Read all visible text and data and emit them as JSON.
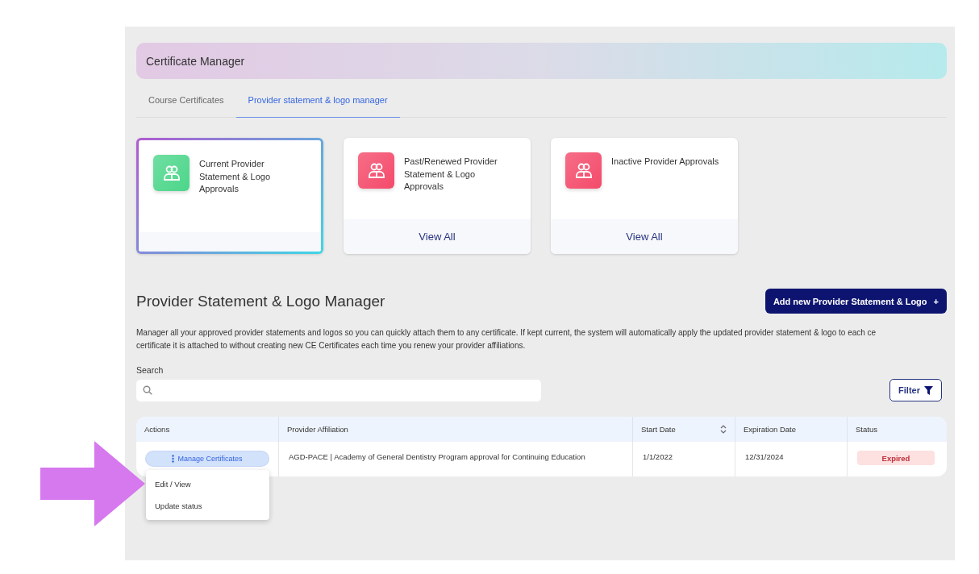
{
  "header": {
    "title": "Certificate Manager"
  },
  "tabs": [
    {
      "label": "Course Certificates",
      "selected": false
    },
    {
      "label": "Provider statement & logo manager",
      "selected": true
    }
  ],
  "cards": [
    {
      "title": "Current Provider Statement & Logo Approvals",
      "selected": true,
      "color": "#4cd68a"
    },
    {
      "title": "Past/Renewed Provider Statement & Logo Approvals",
      "selected": false,
      "color": "#f44a6a",
      "footer": "View All"
    },
    {
      "title": "Inactive Provider Approvals",
      "selected": false,
      "color": "#f44a6a",
      "footer": "View All"
    }
  ],
  "section": {
    "heading": "Provider Statement & Logo Manager",
    "add_button": "Add new Provider Statement & Logo",
    "add_icon": "+",
    "description_lines": [
      "Manager all your approved provider statements and logos so you can quickly attach them to any certificate. If kept current, the system will automatically apply the updated provider statement & logo to each ce",
      "certificate it is attached to without creating new CE Certificates each time you renew your provider affiliations."
    ]
  },
  "search": {
    "label": "Search"
  },
  "filter_button": "Filter",
  "table": {
    "columns": [
      {
        "label": "Actions"
      },
      {
        "label": "Provider Affiliation"
      },
      {
        "label": "Start Date",
        "sortable": true
      },
      {
        "label": "Expiration Date"
      },
      {
        "label": "Status"
      }
    ],
    "rows": [
      {
        "action": "Manage Certificates",
        "expanded": true,
        "menu": [
          "Edit / View",
          "Update status"
        ],
        "affiliation": "AGD-PACE | Academy of General Dentistry Program approval for Continuing Education",
        "start_date": "1/1/2022",
        "expiration_date": "12/31/2024",
        "status": "Expired"
      }
    ]
  }
}
